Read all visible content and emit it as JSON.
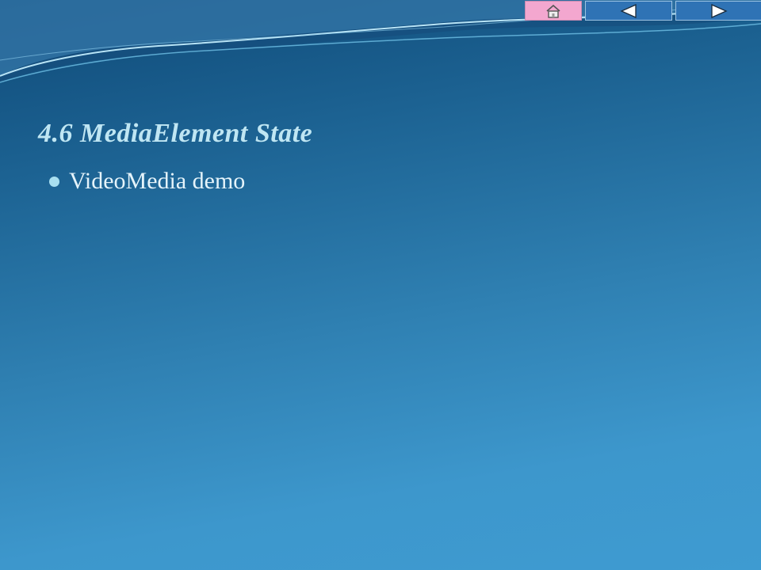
{
  "slide": {
    "title": "4.6 MediaElement State",
    "bullets": [
      {
        "text": "VideoMedia demo"
      }
    ]
  },
  "nav": {
    "home_icon": "home-icon",
    "prev_icon": "previous-arrow-icon",
    "next_icon": "next-arrow-icon"
  },
  "colors": {
    "background_top": "#0f4a78",
    "background_bottom": "#3e9bd1",
    "title": "#bfe6f3",
    "text": "#e4f3fa",
    "home_button": "#f3a7cf",
    "arrow_button": "#2f73b5"
  }
}
